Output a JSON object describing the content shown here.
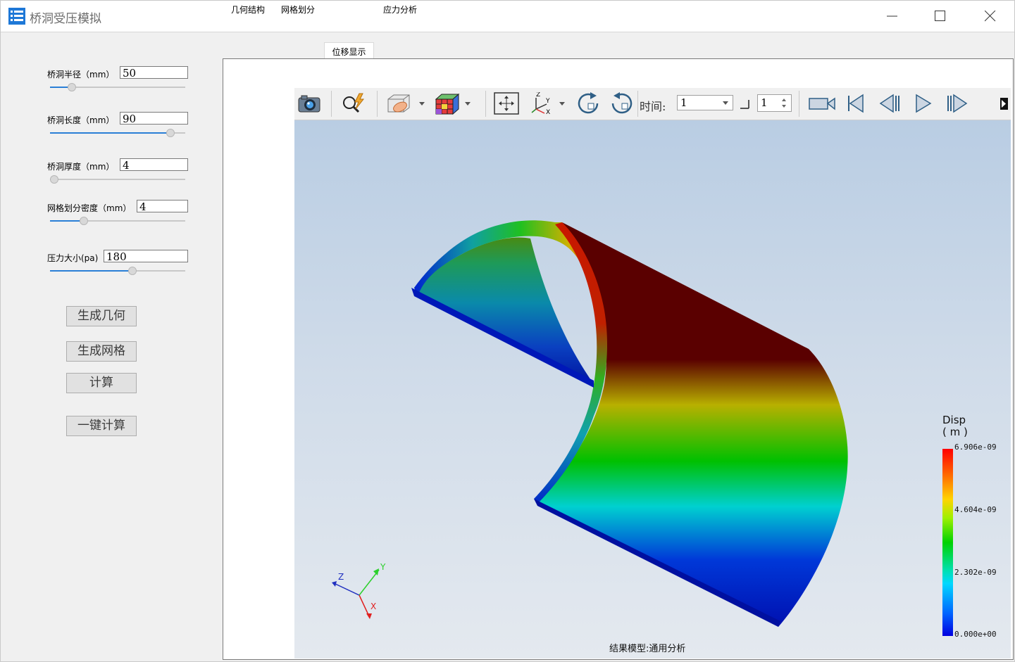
{
  "window": {
    "title": "桥洞受压模拟"
  },
  "params": [
    {
      "label": "桥洞半径（mm）",
      "value": "50",
      "slider_fraction": 0.16
    },
    {
      "label": "桥洞长度（mm）",
      "value": "90",
      "slider_fraction": 0.89
    },
    {
      "label": "桥洞厚度（mm）",
      "value": "4",
      "slider_fraction": 0.03
    },
    {
      "label": "网格划分密度（mm）",
      "value": "4",
      "slider_fraction": 0.25
    },
    {
      "label": "压力大小(pa)",
      "value": "180",
      "slider_fraction": 0.61
    }
  ],
  "buttons": {
    "gen_geometry": "生成几何",
    "gen_mesh": "生成网格",
    "compute": "计算",
    "one_click": "一键计算"
  },
  "tabs": [
    {
      "label": "几何结构",
      "active": false
    },
    {
      "label": "网格划分",
      "active": false
    },
    {
      "label": "位移显示",
      "active": true
    },
    {
      "label": "应力分析",
      "active": false
    }
  ],
  "toolbar": {
    "time_label": "时间:",
    "time_value": "1",
    "step_value": "1"
  },
  "viewport": {
    "caption": "结果模型:通用分析",
    "legend": {
      "title": "Disp",
      "unit": "( m )",
      "ticks": [
        "6.906e-09",
        "4.604e-09",
        "2.302e-09",
        "0.000e+00"
      ]
    },
    "axes": {
      "x": "X",
      "y": "Y",
      "z": "Z"
    }
  },
  "icons": [
    "app-icon",
    "minimize-icon",
    "maximize-icon",
    "close-icon",
    "camera-icon",
    "zoom-icon",
    "clip-plane-icon",
    "mesh-cube-icon",
    "fit-view-icon",
    "axes-icon",
    "rotate-cw-icon",
    "rotate-ccw-icon",
    "video-icon",
    "first-frame-icon",
    "prev-frame-icon",
    "play-icon",
    "next-frame-icon",
    "expand-icon"
  ]
}
